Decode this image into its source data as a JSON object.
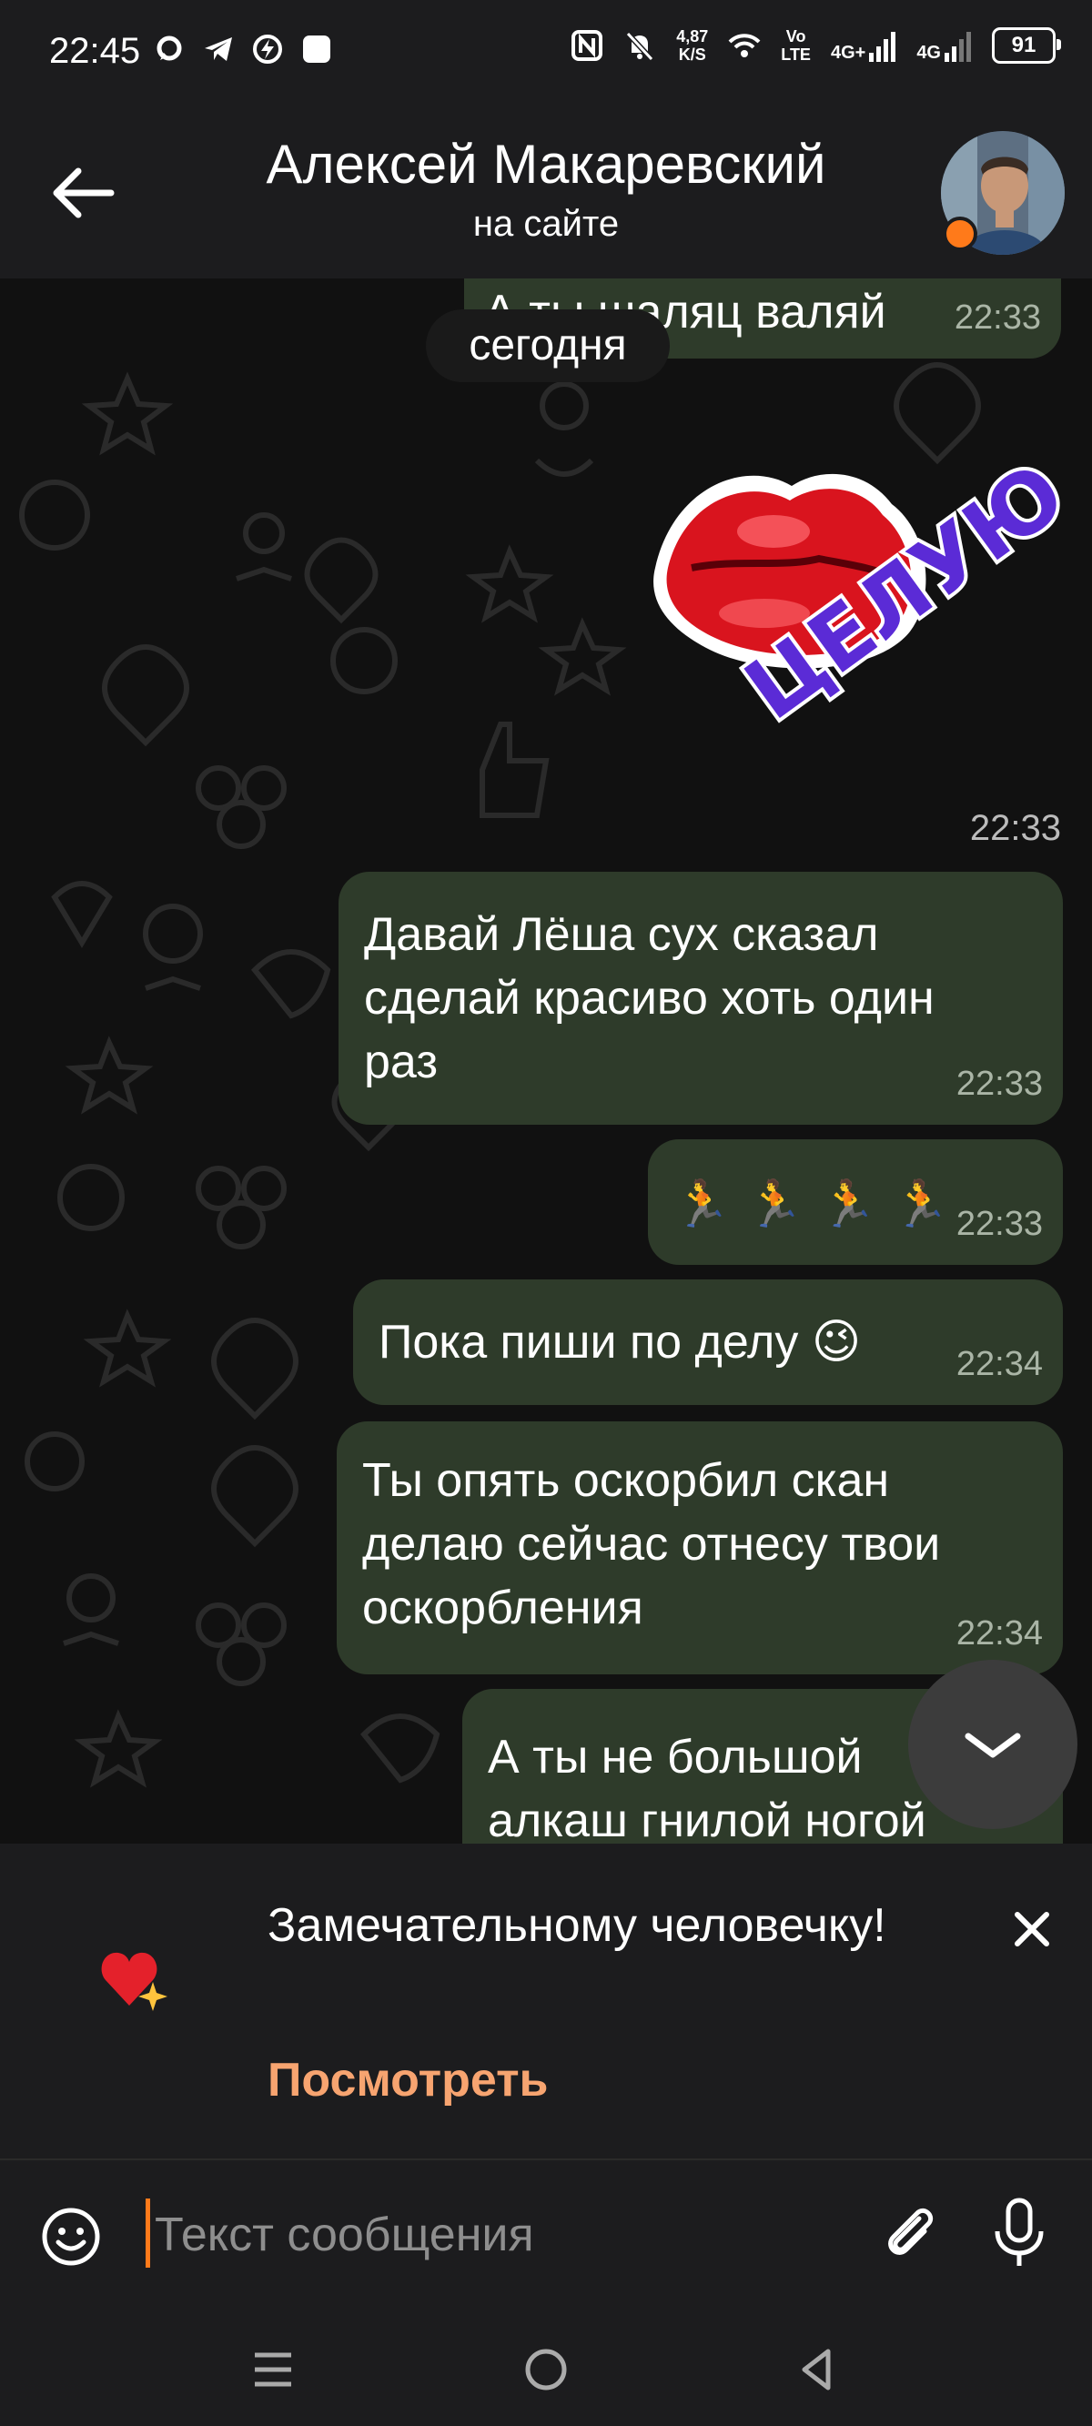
{
  "status_bar": {
    "time": "22:45",
    "speed_value": "4,87",
    "speed_unit": "K/S",
    "volte_top": "Vo",
    "volte_bottom": "LTE",
    "net1": "4G+",
    "net2": "4G",
    "battery": "91"
  },
  "header": {
    "title": "Алексей Макаревский",
    "subtitle": "на сайте"
  },
  "chat": {
    "day_pill": "сегодня",
    "messages": [
      {
        "text": "А ты шаляц валяй",
        "time": "22:33"
      },
      {
        "type": "sticker",
        "sticker_text": "ЦЕЛУЮ",
        "time": "22:33"
      },
      {
        "lines": [
          "Давай Лёша сух сказал",
          "сделай красиво хоть один",
          "раз"
        ],
        "time": "22:33"
      },
      {
        "emoji": [
          "🏃",
          "🏃",
          "🏃",
          "🏃"
        ],
        "time": "22:33"
      },
      {
        "text": "Пока пиши по делу 😉",
        "time": "22:34"
      },
      {
        "lines": [
          "Ты опять оскорбил скан",
          "делаю сейчас отнесу твои",
          "оскорбления"
        ],
        "time": "22:34"
      },
      {
        "lines": [
          "А ты не большой",
          "алкаш гнилой ногой"
        ]
      }
    ]
  },
  "notice": {
    "text": "Замечательному человечку!",
    "link": "Посмотреть"
  },
  "input": {
    "placeholder": "Текст сообщения"
  },
  "colors": {
    "accent": "#ff7a1a",
    "bubble": "#2e3b2a",
    "link": "#f7a470"
  }
}
